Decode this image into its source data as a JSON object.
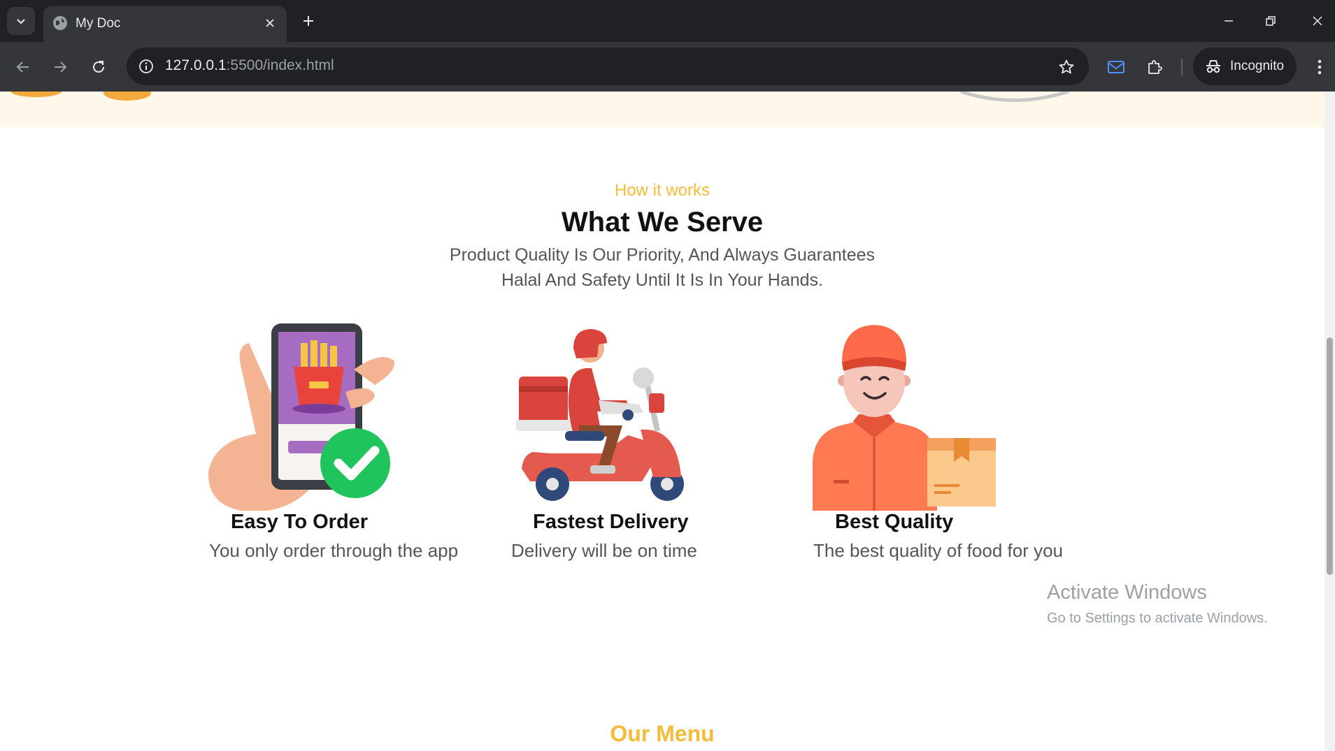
{
  "browser": {
    "tab_title": "My Doc",
    "url_host": "127.0.0.1",
    "url_path": ":5500/index.html",
    "incognito_label": "Incognito"
  },
  "section": {
    "eyebrow": "How it works",
    "headline": "What We Serve",
    "subtext_line1": "Product Quality Is Our Priority, And Always Guarantees",
    "subtext_line2": "Halal And Safety Until It Is In Your Hands."
  },
  "features": [
    {
      "icon": "phone-order-icon",
      "title": "Easy To Order",
      "desc": "You only order through the app"
    },
    {
      "icon": "scooter-delivery-icon",
      "title": "Fastest Delivery",
      "desc": "Delivery will be on time"
    },
    {
      "icon": "courier-box-icon",
      "title": "Best Quality",
      "desc": "The best quality of food for you"
    }
  ],
  "next_section": {
    "title": "Our Menu"
  },
  "os_watermark": {
    "title": "Activate Windows",
    "subtitle": "Go to Settings to activate Windows."
  },
  "colors": {
    "accent": "#f4bc3a",
    "hero_bg": "#fff8ea",
    "chrome_dark": "#202124",
    "chrome_mid": "#35363a"
  }
}
